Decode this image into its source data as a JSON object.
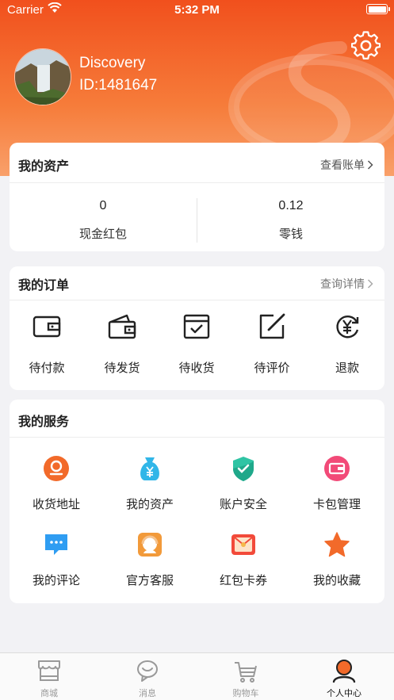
{
  "status_bar": {
    "carrier": "Carrier",
    "time": "5:32 PM"
  },
  "profile": {
    "username": "Discovery",
    "user_id": "ID:1481647"
  },
  "assets": {
    "title": "我的资产",
    "link": "查看账单",
    "items": [
      {
        "value": "0",
        "label": "现金红包"
      },
      {
        "value": "0.12",
        "label": "零钱"
      }
    ]
  },
  "orders": {
    "title": "我的订单",
    "link": "查询详情",
    "items": [
      {
        "label": "待付款",
        "icon": "wallet-icon"
      },
      {
        "label": "待发货",
        "icon": "open-wallet-icon"
      },
      {
        "label": "待收货",
        "icon": "box-check-icon"
      },
      {
        "label": "待评价",
        "icon": "edit-icon"
      },
      {
        "label": "退款",
        "icon": "yen-refund-icon"
      }
    ]
  },
  "services": {
    "title": "我的服务",
    "items": [
      {
        "label": "收货地址",
        "icon": "location-icon",
        "color": "#f26a2a"
      },
      {
        "label": "我的资产",
        "icon": "money-bag-icon",
        "color": "#31b6e8"
      },
      {
        "label": "账户安全",
        "icon": "shield-icon",
        "color": "#2fc4a4"
      },
      {
        "label": "卡包管理",
        "icon": "card-wallet-icon",
        "color": "#f24a78"
      },
      {
        "label": "我的评论",
        "icon": "comment-icon",
        "color": "#2f9df2"
      },
      {
        "label": "官方客服",
        "icon": "customer-service-icon",
        "color": "#f29a3a"
      },
      {
        "label": "红包卡券",
        "icon": "red-envelope-icon",
        "color": "#f24a3a"
      },
      {
        "label": "我的收藏",
        "icon": "star-icon",
        "color": "#f26a2a"
      }
    ]
  },
  "tabbar": {
    "items": [
      {
        "label": "商城",
        "icon": "store-icon",
        "active": false
      },
      {
        "label": "消息",
        "icon": "message-icon",
        "active": false
      },
      {
        "label": "购物车",
        "icon": "cart-icon",
        "active": false
      },
      {
        "label": "个人中心",
        "icon": "person-icon",
        "active": true
      }
    ]
  },
  "colors": {
    "accent": "#f1501d",
    "background": "#f2f2f5"
  }
}
